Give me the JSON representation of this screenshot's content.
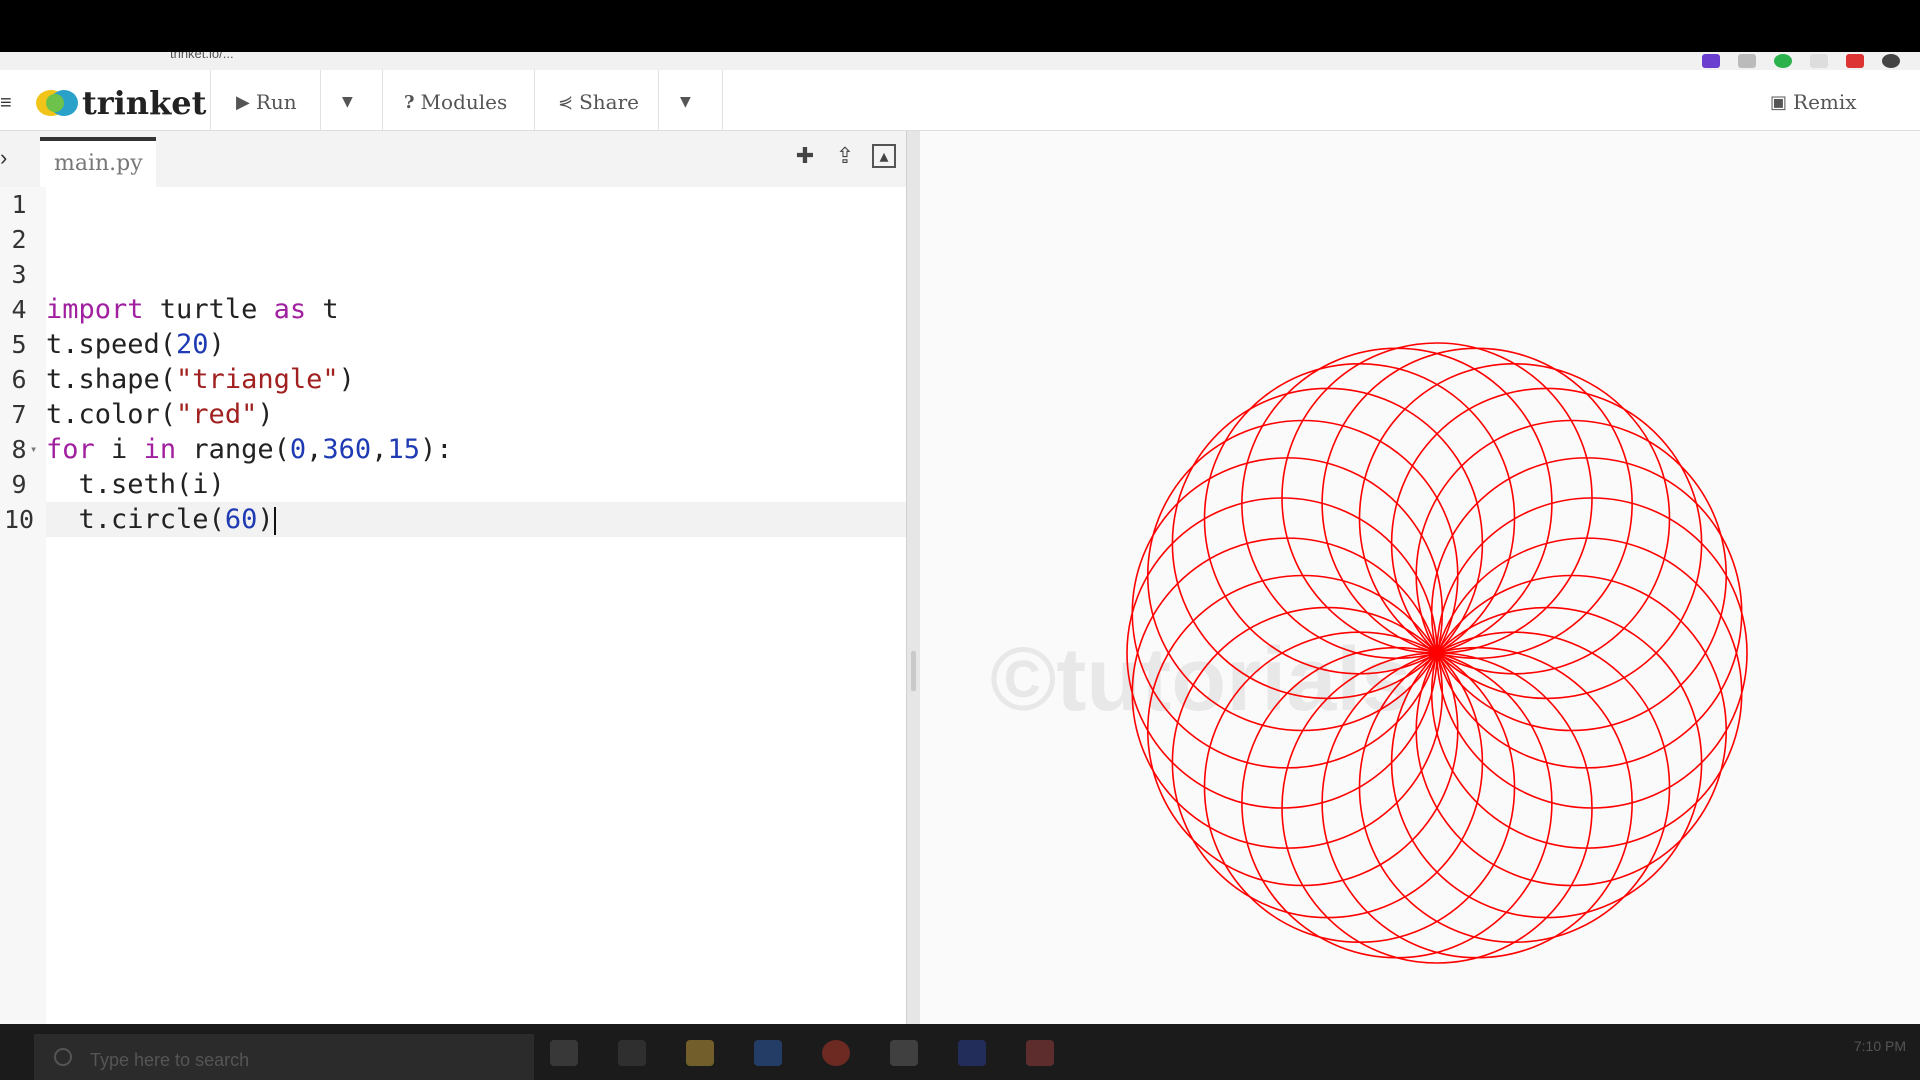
{
  "browser": {
    "url": "trinket.io/..."
  },
  "toolbar": {
    "logo": "trinket",
    "run": "Run",
    "modules": "Modules",
    "share": "Share",
    "remix": "Remix"
  },
  "editor": {
    "tab": "main.py",
    "lines": [
      {
        "n": "1"
      },
      {
        "n": "2"
      },
      {
        "n": "3"
      },
      {
        "n": "4"
      },
      {
        "n": "5"
      },
      {
        "n": "6"
      },
      {
        "n": "7"
      },
      {
        "n": "8"
      },
      {
        "n": "9"
      },
      {
        "n": "10"
      }
    ]
  },
  "output": {
    "drawing": {
      "color": "#ff0000",
      "circles": 24,
      "radius": 60,
      "step_degrees": 15
    },
    "watermark": "©tutorials"
  },
  "taskbar": {
    "search_placeholder": "Type here to search",
    "time": "7:10 PM"
  }
}
